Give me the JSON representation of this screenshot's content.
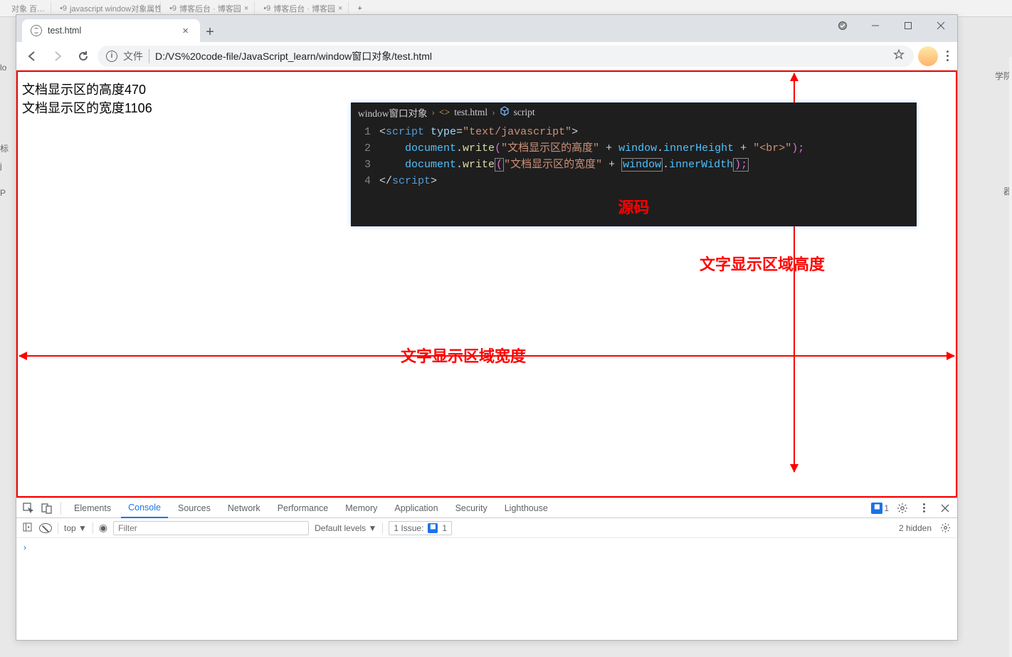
{
  "bg_tabs": {
    "t1": "对象 百…",
    "t2": "javascript window对象属性和…",
    "t3": "博客后台 · 博客园",
    "t4": "博客后台 · 博客园",
    "clip_right": [
      "学院",
      "",
      "",
      "器",
      ""
    ],
    "clip_left": [
      "lo",
      "标",
      "j",
      "P"
    ]
  },
  "window": {
    "min": "minimize",
    "max": "maximize",
    "close": "close"
  },
  "tab": {
    "title": "test.html"
  },
  "toolbar": {
    "file_label": "文件",
    "url": "D:/VS%20code-file/JavaScript_learn/window窗口对象/test.html"
  },
  "page": {
    "line1": "文档显示区的高度470",
    "line2": "文档显示区的宽度1106"
  },
  "annotations": {
    "source_label": "源码",
    "height_label": "文字显示区域高度",
    "width_label": "文字显示区域宽度"
  },
  "editor": {
    "crumbs": [
      "window窗口对象",
      "test.html",
      "script"
    ],
    "lines": [
      "1",
      "2",
      "3",
      "4"
    ],
    "code": {
      "l1_a": "<",
      "l1_b": "script",
      "l1_c": " type",
      "l1_d": "=",
      "l1_e": "\"text/javascript\"",
      "l1_f": ">",
      "l2_a": "document",
      "l2_b": ".",
      "l2_c": "write",
      "l2_d": "(",
      "l2_e": "\"文档显示区的高度\"",
      "l2_f": " + ",
      "l2_g": "window",
      "l2_h": ".",
      "l2_i": "innerHeight",
      "l2_j": " + ",
      "l2_k": "\"<br>\"",
      "l2_l": ");",
      "l3_a": "document",
      "l3_b": ".",
      "l3_c": "write",
      "l3_d": "(",
      "l3_e": "\"文档显示区的宽度\"",
      "l3_f": " + ",
      "l3_g": "window",
      "l3_h": ".",
      "l3_i": "innerWidth",
      "l3_j": ");",
      "l4_a": "</",
      "l4_b": "script",
      "l4_c": ">"
    }
  },
  "devtools": {
    "tabs": [
      "Elements",
      "Console",
      "Sources",
      "Network",
      "Performance",
      "Memory",
      "Application",
      "Security",
      "Lighthouse"
    ],
    "active_tab_index": 1,
    "badge_count": "1",
    "subbar": {
      "context": "top ▼",
      "filter_placeholder": "Filter",
      "levels": "Default levels ▼",
      "issue_label": "1 Issue:",
      "issue_count": "1",
      "hidden": "2 hidden"
    },
    "prompt": "›"
  }
}
